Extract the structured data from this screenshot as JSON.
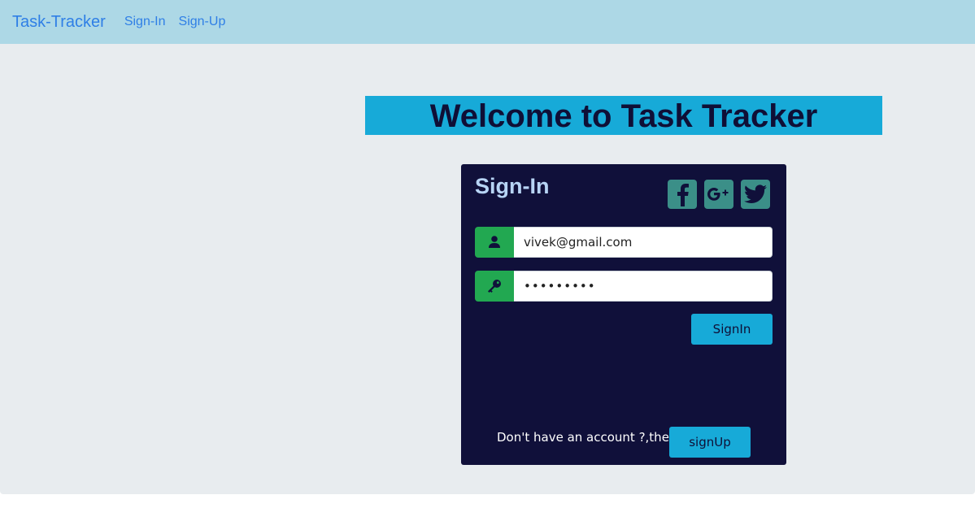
{
  "navbar": {
    "brand": "Task-Tracker",
    "links": [
      "Sign-In",
      "Sign-Up"
    ]
  },
  "welcome": {
    "title": "Welcome to Task Tracker"
  },
  "signin": {
    "title": "Sign-In",
    "social_icons": [
      "facebook-icon",
      "google-plus-icon",
      "twitter-icon"
    ],
    "email": {
      "value": "vivek@gmail.com",
      "icon": "user-icon"
    },
    "password": {
      "value": "vivek1234",
      "icon": "key-icon"
    },
    "submit_label": "SignIn",
    "footer_text": "Don't have an account ?,then..",
    "signup_label": "signUp"
  },
  "colors": {
    "navbar_bg": "#add8e6",
    "link": "#2f7fe6",
    "banner_bg": "#17aad8",
    "card_bg": "#10103a",
    "input_prefix": "#22a851",
    "social_bg": "#3b8f88"
  }
}
